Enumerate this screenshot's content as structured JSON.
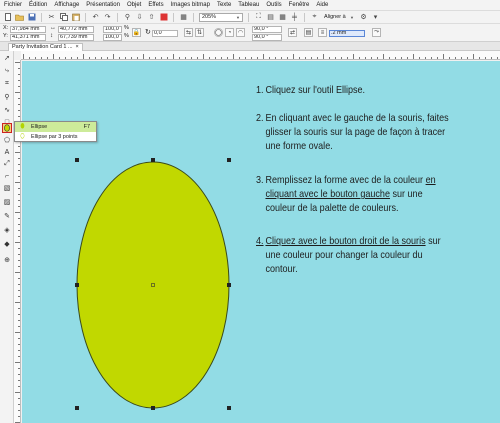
{
  "menu": [
    "Fichier",
    "Édition",
    "Affichage",
    "Présentation",
    "Objet",
    "Effets",
    "Images bitmap",
    "Texte",
    "Tableau",
    "Outils",
    "Fenêtre",
    "Aide"
  ],
  "toolbar": {
    "zoom": "205%",
    "align_label": "Aligner à"
  },
  "propbar": {
    "x_label": "X:",
    "x_value": "37,984 mm",
    "y_label": "Y:",
    "y_value": "41,371 mm",
    "w_value": "40,772 mm",
    "h_value": "67,739 mm",
    "scale_x": "100,0",
    "scale_y": "100,0",
    "percent": "%",
    "rotation": "0,0",
    "angle_start": "90,0 °",
    "angle_end": "90,0 °",
    "outline": ".2 mm"
  },
  "document_tab": {
    "title": "Party Invitation Card 1 ...",
    "close": "×"
  },
  "flyout": {
    "items": [
      {
        "label": "Ellipse",
        "shortcut": "F7"
      },
      {
        "label": "Ellipse par 3 points",
        "shortcut": ""
      }
    ]
  },
  "instructions": {
    "step1": {
      "num": "1.",
      "text": "Cliquez sur l'outil Ellipse."
    },
    "step2": {
      "num": "2.",
      "text": "En cliquant avec le gauche de la souris, faites glisser la souris sur la page de façon à tracer une forme ovale."
    },
    "step3": {
      "num": "3.",
      "part1": "Remplissez la forme avec de la couleur ",
      "part2": "en cliquant avec le bouton gauche",
      "part3": " sur une couleur de la palette de couleurs."
    },
    "step4": {
      "num": "4.",
      "part1": "Cliquez avec le bouton droit de la souris",
      "part2": " sur une couleur pour changer la couleur du contour."
    }
  },
  "colors": {
    "canvas": "#92dce5",
    "ellipse_fill": "#c1d800",
    "ellipse_stroke": "#3a4a1a",
    "flyout_highlight": "#cdeb9a"
  }
}
